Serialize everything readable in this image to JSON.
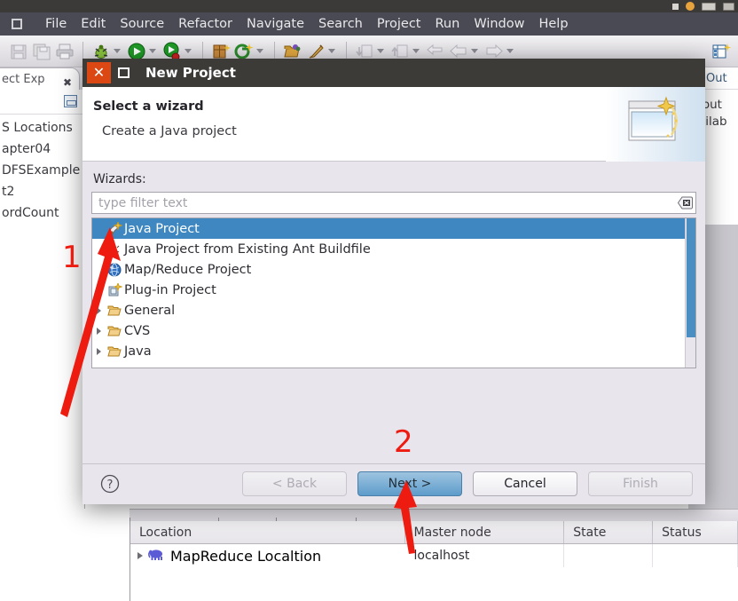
{
  "desktop": {
    "tray_icons": [
      "notifications-icon",
      "user-icon",
      "keyboard-icon",
      "battery-icon"
    ]
  },
  "menubar": {
    "window_button_icon": "restore-window-icon",
    "items": [
      "File",
      "Edit",
      "Source",
      "Refactor",
      "Navigate",
      "Search",
      "Project",
      "Run",
      "Window",
      "Help"
    ]
  },
  "toolbar": {
    "groups": [
      {
        "buttons": [
          {
            "name": "save-icon",
            "dropdown": false
          },
          {
            "name": "save-all-icon",
            "dropdown": false
          },
          {
            "name": "print-icon",
            "dropdown": false
          }
        ]
      },
      {
        "buttons": [
          {
            "name": "debug-icon",
            "dropdown": true
          },
          {
            "name": "run-icon",
            "dropdown": true
          },
          {
            "name": "run-coverage-icon",
            "dropdown": true
          }
        ]
      },
      {
        "buttons": [
          {
            "name": "new-java-package-icon",
            "dropdown": false
          },
          {
            "name": "new-java-class-icon",
            "dropdown": true
          }
        ]
      },
      {
        "buttons": [
          {
            "name": "open-type-icon",
            "dropdown": false
          },
          {
            "name": "external-tools-icon",
            "dropdown": true
          }
        ]
      },
      {
        "buttons": [
          {
            "name": "next-annotation-icon",
            "dropdown": true
          },
          {
            "name": "previous-annotation-icon",
            "dropdown": true
          },
          {
            "name": "last-edit-location-icon",
            "dropdown": false
          },
          {
            "name": "back-icon",
            "dropdown": true
          },
          {
            "name": "forward-icon",
            "dropdown": true
          }
        ]
      }
    ],
    "right_button": "new-mapreduce-location-icon"
  },
  "left_view": {
    "tab_label": "ect Exp",
    "tab_close_icon": "close-icon",
    "collapse_all_icon": "collapse-all-icon",
    "tree_items": [
      "S Locations",
      "apter04",
      "DFSExample",
      "t2",
      "ordCount"
    ]
  },
  "right_view": {
    "tab_icon": "outline-icon",
    "tab_label": "Out",
    "body_lines": [
      "n out",
      "vailab"
    ]
  },
  "dialog": {
    "title": "New Project",
    "close_icon": "close-icon",
    "maximize_icon": "maximize-icon",
    "heading": "Select a wizard",
    "subheading": "Create a Java project",
    "banner_icon": "new-wizard-banner-icon",
    "wizards_label": "Wizards:",
    "filter": {
      "value": "",
      "placeholder": "type filter text",
      "clear_icon": "clear-field-icon"
    },
    "wizards": [
      {
        "label": "Java Project",
        "icon": "java-project-icon",
        "selected": true,
        "expandable": false
      },
      {
        "label": "Java Project from Existing Ant Buildfile",
        "icon": "ant-buildfile-icon",
        "selected": false,
        "expandable": false
      },
      {
        "label": "Map/Reduce Project",
        "icon": "mapreduce-project-icon",
        "selected": false,
        "expandable": false
      },
      {
        "label": "Plug-in Project",
        "icon": "plugin-project-icon",
        "selected": false,
        "expandable": false
      },
      {
        "label": "General",
        "icon": "folder-icon",
        "selected": false,
        "expandable": true
      },
      {
        "label": "CVS",
        "icon": "folder-icon",
        "selected": false,
        "expandable": true
      },
      {
        "label": "Java",
        "icon": "folder-icon",
        "selected": false,
        "expandable": true
      }
    ],
    "help_icon": "help-icon",
    "buttons": {
      "back": "< Back",
      "next": "Next >",
      "cancel": "Cancel",
      "finish": "Finish"
    }
  },
  "bottom_view": {
    "columns": [
      "Location",
      "Master node",
      "State",
      "Status"
    ],
    "rows": [
      {
        "location": "MapReduce Localtion",
        "master_node": "localhost",
        "state": "",
        "status": "",
        "icon": "hadoop-elephant-icon",
        "expandable": true
      }
    ]
  },
  "annotations": [
    {
      "label": "1",
      "target": "java-project-list-item"
    },
    {
      "label": "2",
      "target": "next-button"
    }
  ],
  "colors": {
    "accent_selection": "#3f87c0",
    "annotation_red": "#ee1b11",
    "titlebar": "#3c3b38",
    "close_button": "#db4814",
    "menubar": "#4a4a55",
    "default_button": "#5d9ccb"
  }
}
